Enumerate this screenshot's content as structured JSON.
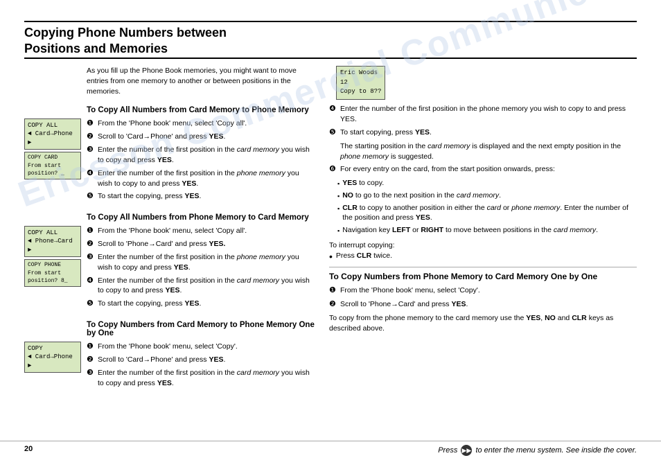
{
  "title": {
    "line1": "Copying Phone Numbers between",
    "line2": "Positions and Memories"
  },
  "intro": "As you fill up the Phone Book memories, you might want to move entries from one memory to another or between positions in the memories.",
  "section1": {
    "heading": "To Copy All Numbers from Card Memory to Phone Memory",
    "lcd1": {
      "line1": "COPY ALL",
      "line2": "◄ Card→Phone ►"
    },
    "lcd2": {
      "line1": "COPY CARD",
      "line2": "From start",
      "line3": "position?  _"
    },
    "steps": [
      {
        "num": "❶",
        "text": "From the 'Phone book' menu, select 'Copy all'."
      },
      {
        "num": "❷",
        "text": "Scroll to 'Card→Phone' and press YES."
      },
      {
        "num": "❸",
        "text": "Enter the number of the first position in the card memory you wish to copy and press YES."
      },
      {
        "num": "❹",
        "text": "Enter the number of the first position in the phone memory you wish to copy to and press YES."
      },
      {
        "num": "❺",
        "text": "To start the copying, press YES."
      }
    ]
  },
  "section2": {
    "heading": "To Copy All Numbers from Phone Memory to Card Memory",
    "lcd1": {
      "line1": "COPY ALL",
      "line2": "◄ Phone→Card ►"
    },
    "lcd2": {
      "line1": "COPY PHONE",
      "line2": "From start",
      "line3": "position?  8_"
    },
    "steps": [
      {
        "num": "❶",
        "text": "From the 'Phone book' menu, select 'Copy all'."
      },
      {
        "num": "❷",
        "text": "Scroll to 'Phone→Card' and press YES."
      },
      {
        "num": "❸",
        "text": "Enter the number of the first position in the phone memory you wish to copy and press YES."
      },
      {
        "num": "❹",
        "text": "Enter the number of the first position in the card memory you wish to copy to and press YES."
      },
      {
        "num": "❺",
        "text": "To start the copying, press YES."
      }
    ]
  },
  "section3": {
    "heading": "To Copy Numbers from Card Memory to Phone Memory One by One",
    "lcd1": {
      "line1": "COPY",
      "line2": "◄ Card→Phone ►"
    },
    "steps": [
      {
        "num": "❶",
        "text": "From the 'Phone book' menu, select 'Copy'."
      },
      {
        "num": "❷",
        "text": "Scroll to 'Card→Phone' and press YES."
      },
      {
        "num": "❸",
        "text": "Enter the number of the first position in the card memory you wish to copy and press YES."
      }
    ]
  },
  "right_col": {
    "step4_heading": "❹",
    "step4": "Enter the number of the first position in the phone memory you wish to copy to and press YES.",
    "step5_heading": "❺",
    "step5": "To start copying, press YES.",
    "step5_note": "The starting position in the card memory is displayed and the next empty position in the phone memory is suggested.",
    "step6_heading": "❻",
    "step6": "For every entry on the card, from the start position onwards, press:",
    "bullets": [
      {
        "sym": "▪",
        "text": "YES to copy."
      },
      {
        "sym": "▪",
        "text": "NO to go to the next position in the card memory."
      },
      {
        "sym": "▪",
        "text": "CLR to copy to another position in either the card or phone memory. Enter the number of the position and press YES."
      },
      {
        "sym": "▪",
        "text": "Navigation key LEFT or RIGHT to move between positions in the card memory."
      }
    ],
    "interrupt_label": "To interrupt copying:",
    "interrupt_bullet": "Press CLR twice.",
    "mini_lcd": {
      "line1": "Eric Woods",
      "line2": "     12",
      "line3": "Copy to   8??"
    },
    "section4": {
      "heading": "To Copy Numbers from Phone Memory to Card Memory One by One",
      "steps": [
        {
          "num": "❶",
          "text": "From the 'Phone book' menu, select 'Copy'."
        },
        {
          "num": "❷",
          "text": "Scroll to 'Phone→Card' and press YES."
        }
      ],
      "note": "To copy from the phone memory to the card memory use the YES, NO and CLR keys as described above."
    }
  },
  "footer": {
    "page": "20",
    "note": "Press       to enter the menu system. See inside the cover."
  }
}
